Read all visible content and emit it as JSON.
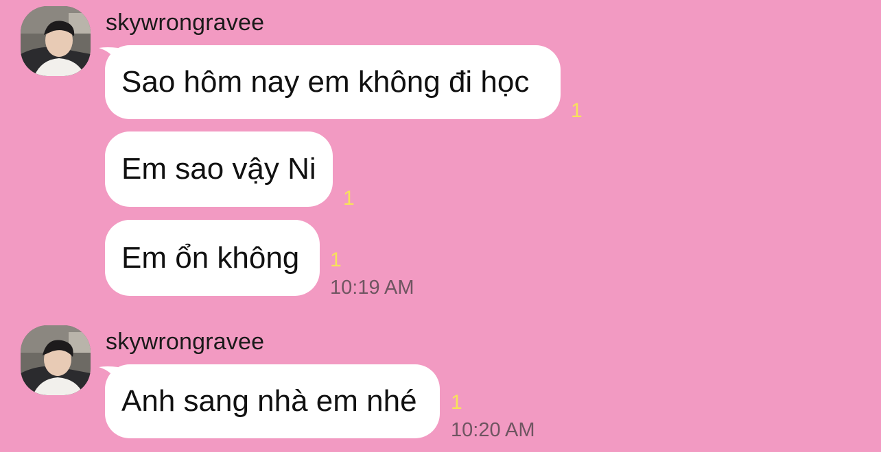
{
  "colors": {
    "background": "#f29ac2",
    "bubble": "#ffffff",
    "unread_count": "#f7e35a",
    "timestamp": "#6f5561"
  },
  "groups": [
    {
      "sender": "skywrongravee",
      "avatar_icon": "profile-photo",
      "messages": [
        {
          "text": "Sao hôm nay em không đi học",
          "unread": "1"
        },
        {
          "text": "Em sao vậy Ni",
          "unread": "1"
        },
        {
          "text": "Em ổn không",
          "unread": "1"
        }
      ],
      "time": "10:19 AM"
    },
    {
      "sender": "skywrongravee",
      "avatar_icon": "profile-photo",
      "messages": [
        {
          "text": "Anh sang nhà em nhé",
          "unread": "1"
        }
      ],
      "time": "10:20 AM"
    }
  ]
}
